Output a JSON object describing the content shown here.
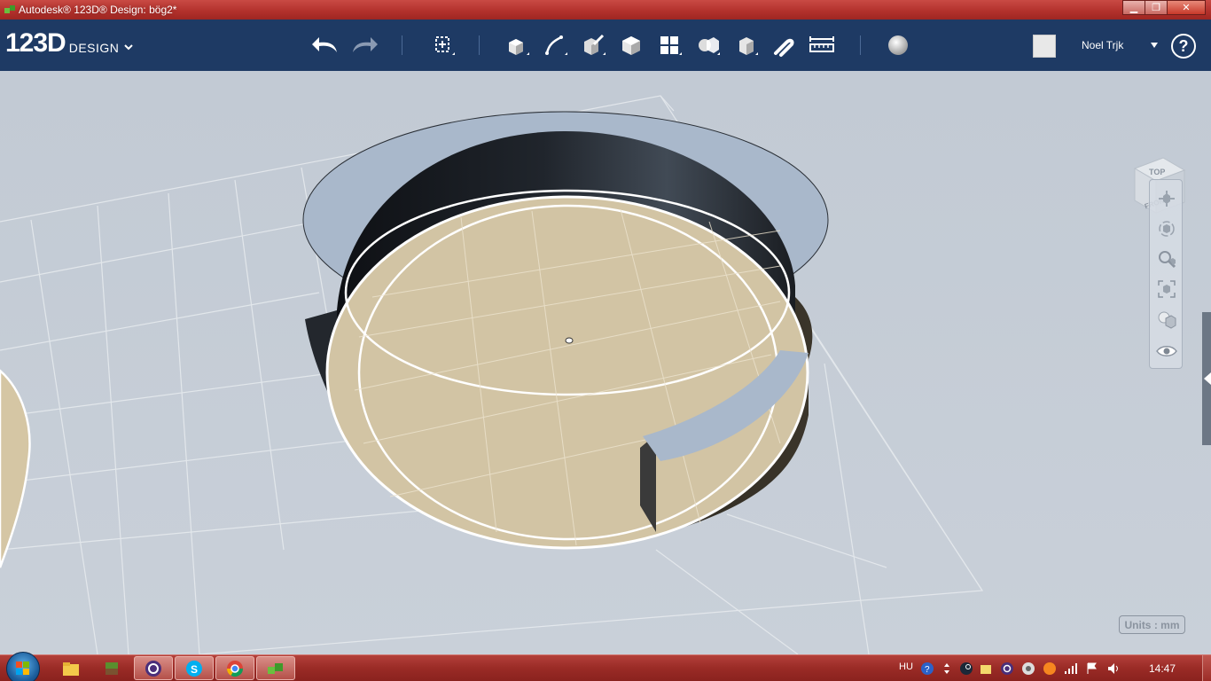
{
  "window": {
    "title": "Autodesk® 123D® Design: bög2*",
    "buttons": {
      "minimize": "▁",
      "maximize": "❐",
      "close": "✕"
    }
  },
  "app": {
    "logo_main": "123D",
    "logo_sub": "DESIGN",
    "user_name": "Noel Trjk",
    "help_label": "?"
  },
  "toolbar_icons": [
    "undo-icon",
    "redo-icon",
    "transform-icon",
    "primitives-icon",
    "sketch-icon",
    "construct-icon",
    "modify-icon",
    "pattern-icon",
    "grouping-icon",
    "combine-icon",
    "snap-icon",
    "measure-icon",
    "material-icon"
  ],
  "viewcube": {
    "top_label": "TOP",
    "front_label": "FRONT"
  },
  "navbar_icons": [
    "pan-icon",
    "orbit-icon",
    "zoom-icon",
    "fit-icon",
    "view-style-icon",
    "visibility-icon"
  ],
  "units_label": "Units : mm",
  "taskbar": {
    "apps": [
      "explorer",
      "minecraft",
      "app-c",
      "skype",
      "chrome",
      "123d-design"
    ],
    "language": "HU",
    "time": "14:47"
  },
  "colors": {
    "titlebar": "#b3322d",
    "toolbar": "#1e3a64",
    "viewport": "#c4ccd6",
    "floor": "#d0c4a8",
    "taskbar": "#9a2b26"
  }
}
